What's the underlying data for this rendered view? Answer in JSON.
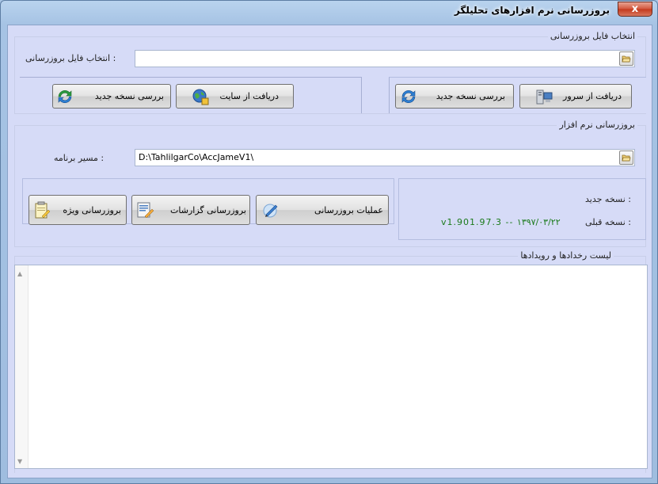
{
  "window": {
    "title": "بروزرسانی نرم افزارهای تحلیلگر",
    "close_label": "x"
  },
  "file_group": {
    "title": "انتخاب فایل بروزرسانی",
    "field_label": ": انتخاب فایل بروزرسانی",
    "field_value": "",
    "buttons": {
      "download_server": "دریافت از سرور",
      "check_new_right": "بررسی نسخه جدید",
      "download_site": "دریافت از سایت",
      "check_new_left": "بررسی نسخه جدید"
    }
  },
  "update_group": {
    "title": "بروزرسانی نرم افزار",
    "path_label": ": مسیر برنامه",
    "path_value": "D:\\TahlilgarCo\\AccJameV1\\",
    "new_version_label": ": نسخه جدید",
    "new_version_value": "",
    "old_version_label": ": نسخه قبلی",
    "old_version_value": "v1.901.97.3 -- ۱۳۹۷/۰۳/۲۲",
    "buttons": {
      "update_ops": "عملیات بروزرسانی",
      "update_reports": "بروزرسانی گزارشات",
      "special_update": "بروزرسانی ویژه"
    }
  },
  "events_group": {
    "title": "لیست رخدادها و رویدادها",
    "items": []
  },
  "icons": {
    "folder": "folder-open-icon",
    "server": "computer-server-icon",
    "refresh": "refresh-arrows-icon",
    "site": "globe-download-icon",
    "update_ops": "pen-edit-icon",
    "reports": "report-edit-icon",
    "special": "notepad-pencil-icon"
  },
  "colors": {
    "client_bg": "#d6dbf7",
    "version_old": "#1b7a1b"
  }
}
